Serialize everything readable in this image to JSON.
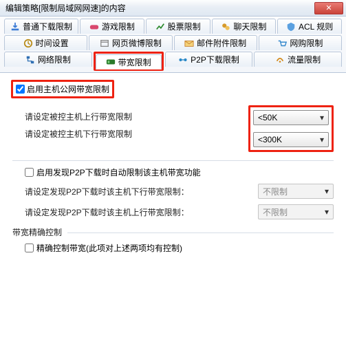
{
  "window": {
    "title": "编辑策略[限制局域网网速]的内容"
  },
  "tabs": {
    "row1": [
      {
        "label": "普通下载限制",
        "icon": "download-icon",
        "color": "#3a7bd5"
      },
      {
        "label": "游戏限制",
        "icon": "game-icon",
        "color": "#d9486e"
      },
      {
        "label": "股票限制",
        "icon": "stock-icon",
        "color": "#2e8b2e"
      },
      {
        "label": "聊天限制",
        "icon": "chat-icon",
        "color": "#d69a2b"
      },
      {
        "label": "ACL 规则",
        "icon": "acl-icon",
        "color": "#5aa0e0"
      }
    ],
    "row2": [
      {
        "label": "时间设置",
        "icon": "time-icon",
        "color": "#b88a15"
      },
      {
        "label": "网页微博限制",
        "icon": "web-icon",
        "color": "#888"
      },
      {
        "label": "邮件附件限制",
        "icon": "mail-icon",
        "color": "#c77f2a"
      },
      {
        "label": "网购限制",
        "icon": "shop-icon",
        "color": "#3388cc"
      }
    ],
    "row3": [
      {
        "label": "网络限制",
        "icon": "net-icon",
        "color": "#2f6fb3"
      },
      {
        "label": "带宽限制",
        "icon": "bw-icon",
        "color": "#2a7a2a",
        "active": true
      },
      {
        "label": "P2P下载限制",
        "icon": "p2p-icon",
        "color": "#2a89c7"
      },
      {
        "label": "流量限制",
        "icon": "flow-icon",
        "color": "#d38b1e"
      }
    ]
  },
  "bw": {
    "enable_label": "启用主机公网带宽限制",
    "enable_checked": true,
    "up_label": "请设定被控主机上行带宽限制",
    "up_value": "<50K",
    "down_label": "请设定被控主机下行带宽限制",
    "down_value": "<300K"
  },
  "p2p": {
    "enable_label": "启用发现P2P下载时自动限制该主机带宽功能",
    "enable_checked": false,
    "down_label": "请设定发现P2P下载时该主机下行带宽限制：",
    "up_label": "请设定发现P2P下载时该主机上行带宽限制：",
    "unlimited": "不限制"
  },
  "precise": {
    "group_label": "带宽精确控制",
    "enable_label": "精确控制带宽(此项对上述两项均有控制)",
    "enable_checked": false
  }
}
